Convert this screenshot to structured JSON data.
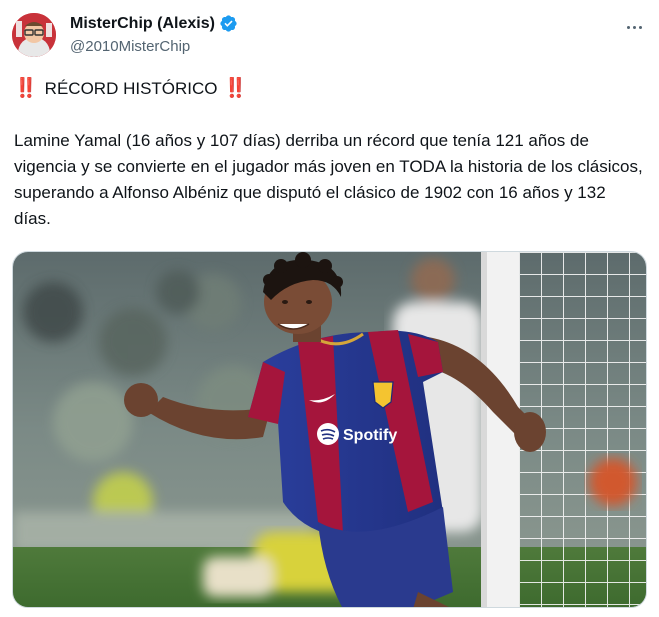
{
  "author": {
    "display_name": "MisterChip (Alexis)",
    "handle": "@2010MisterChip",
    "avatar_icon": "cartoon-avatar-icon",
    "verified_icon": "verified-badge-icon"
  },
  "menu": {
    "icon": "more-options-icon"
  },
  "tweet": {
    "headline": "RÉCORD HISTÓRICO",
    "emoji": "‼️",
    "body": "Lamine Yamal (16 años y 107 días) derriba un récord que tenía 121 años de vigencia y se convierte en el jugador más joven en TODA la historia de los clásicos, superando a Alfonso Albéniz que disputó el clásico de 1902 con 16 años y 132 días."
  },
  "media": {
    "jersey_sponsor": "Spotify"
  },
  "colors": {
    "brand_blue": "#1d9bf0",
    "name": "#0f1419",
    "secondary": "#536471",
    "alert_red": "#d4202c"
  }
}
